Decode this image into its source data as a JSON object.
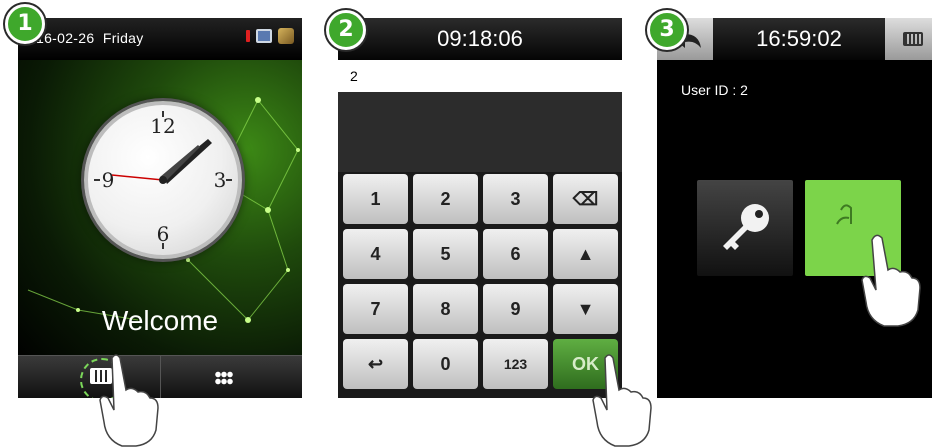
{
  "steps": [
    "1",
    "2",
    "3"
  ],
  "screen1": {
    "date": "16-02-26",
    "weekday": "Friday",
    "clock_numerals": [
      "12",
      "3",
      "6",
      "9"
    ],
    "welcome": "Welcome",
    "icons": [
      "alarm-indicator-icon",
      "network-icon",
      "system-icon",
      "keyboard-icon",
      "menu-grid-icon"
    ]
  },
  "screen2": {
    "time": "09:18:06",
    "input_value": "2",
    "keys": [
      "1",
      "2",
      "3",
      "⌫",
      "4",
      "5",
      "6",
      "▲",
      "7",
      "8",
      "9",
      "▼",
      "↩",
      "0",
      "123",
      "OK"
    ]
  },
  "screen3": {
    "time": "16:59:02",
    "user_id_text": "User ID : 2",
    "icons": [
      "back-icon",
      "keyboard-icon",
      "key-icon",
      "fingerprint-icon"
    ]
  },
  "colors": {
    "badge": "#3fa82c",
    "ok_button": "#4f9b35",
    "fingerprint_tile": "#7cd44a"
  }
}
